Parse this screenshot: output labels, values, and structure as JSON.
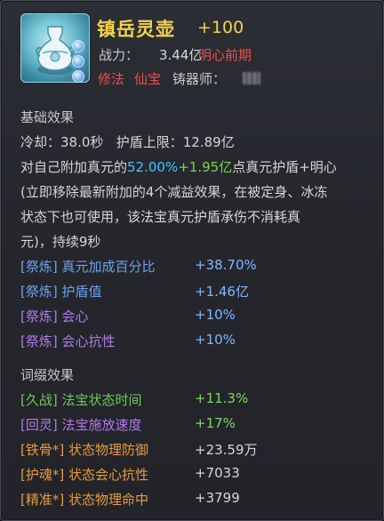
{
  "header": {
    "name": "镇岳灵壶",
    "level": "+100",
    "power_label": "战力：",
    "power_value": "3.44亿",
    "stage": "明心前期",
    "tag_school": "修法",
    "tag_type": "仙宝",
    "smith_label": "铸器师："
  },
  "base_section": {
    "title": "基础效果",
    "cooldown_label": "冷却：",
    "cooldown_value": "38.0秒",
    "shield_cap_label": "护盾上限：",
    "shield_cap_value": "12.89亿",
    "desc_prefix": "对自己附加真元的",
    "desc_pct": "52.00%",
    "desc_plus": "+",
    "desc_amount": "1.95亿",
    "desc_suffix": "点真元护盾+明心",
    "desc_line2": "(立即移除最新附加的4个减益效果，在被定身、冰冻",
    "desc_line3": "状态下也可使用，该法宝真元护盾承伤不消耗真",
    "desc_line4": "元)，持续9秒"
  },
  "refine_rows": [
    {
      "tag": "[祭炼]",
      "name": "真元加成百分比",
      "value": "+38.70%"
    },
    {
      "tag": "[祭炼]",
      "name": "护盾值",
      "value": "+1.46亿"
    },
    {
      "tag": "[祭炼]",
      "name": "会心",
      "value": "+10%"
    },
    {
      "tag": "[祭炼]",
      "name": "会心抗性",
      "value": "+10%"
    }
  ],
  "affix_section": {
    "title": "词缀效果"
  },
  "affix_rows": [
    {
      "tag": "[久战]",
      "name": "法宝状态时间",
      "value": "+11.3%"
    },
    {
      "tag": "[回灵]",
      "name": "法宝施放速度",
      "value": "+17%"
    },
    {
      "tag": "[铁骨*]",
      "name": "状态物理防御",
      "value": "+23.59万"
    },
    {
      "tag": "[护魂*]",
      "name": "状态会心抗性",
      "value": "+7033"
    },
    {
      "tag": "[精准*]",
      "name": "状态物理命中",
      "value": "+3799"
    }
  ],
  "colors": {
    "title_gold": "#f2d24c",
    "stage_red": "#e65050",
    "highlight_cyan": "#44c2ff",
    "highlight_green": "#78d64a",
    "refine_blue": "#6fa0ea",
    "refine_purple": "#b07ae8",
    "affix_green": "#6fc85a",
    "affix_orange": "#e99a3d"
  },
  "icons": [
    "magic-vase-icon",
    "gem-socket-icon"
  ]
}
